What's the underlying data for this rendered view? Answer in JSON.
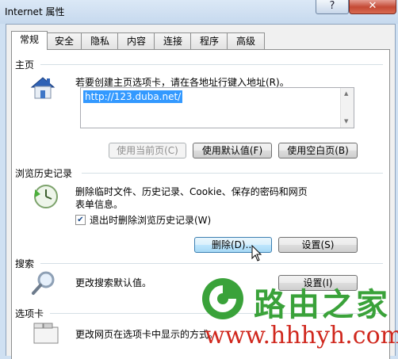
{
  "window": {
    "title": "Internet 属性",
    "help_glyph": "?",
    "close_glyph": "✕"
  },
  "tabs": [
    "常规",
    "安全",
    "隐私",
    "内容",
    "连接",
    "程序",
    "高级"
  ],
  "homepage": {
    "section_title": "主页",
    "description": "若要创建主页选项卡，请在各地址行键入地址(R)。",
    "url": "http://123.duba.net/",
    "btn_current": "使用当前页(C)",
    "btn_default": "使用默认值(F)",
    "btn_blank": "使用空白页(B)"
  },
  "history": {
    "section_title": "浏览历史记录",
    "description_line1": "删除临时文件、历史记录、Cookie、保存的密码和网页",
    "description_line2": "表单信息。",
    "checkbox_label": "退出时删除浏览历史记录(W)",
    "checkbox_checked": true,
    "btn_delete": "删除(D)...",
    "btn_settings": "设置(S)"
  },
  "search": {
    "section_title": "搜索",
    "description": "更改搜索默认值。",
    "btn_settings": "设置(I)"
  },
  "tabs_section": {
    "section_title": "选项卡",
    "description": "更改网页在选项卡中显示的方式。"
  },
  "watermark": {
    "brand": "路由之家",
    "url": "www.hhhyh.com"
  },
  "colors": {
    "selection": "#3399ff",
    "watermark_green": "#3aa23a",
    "watermark_red": "#d0281e"
  }
}
